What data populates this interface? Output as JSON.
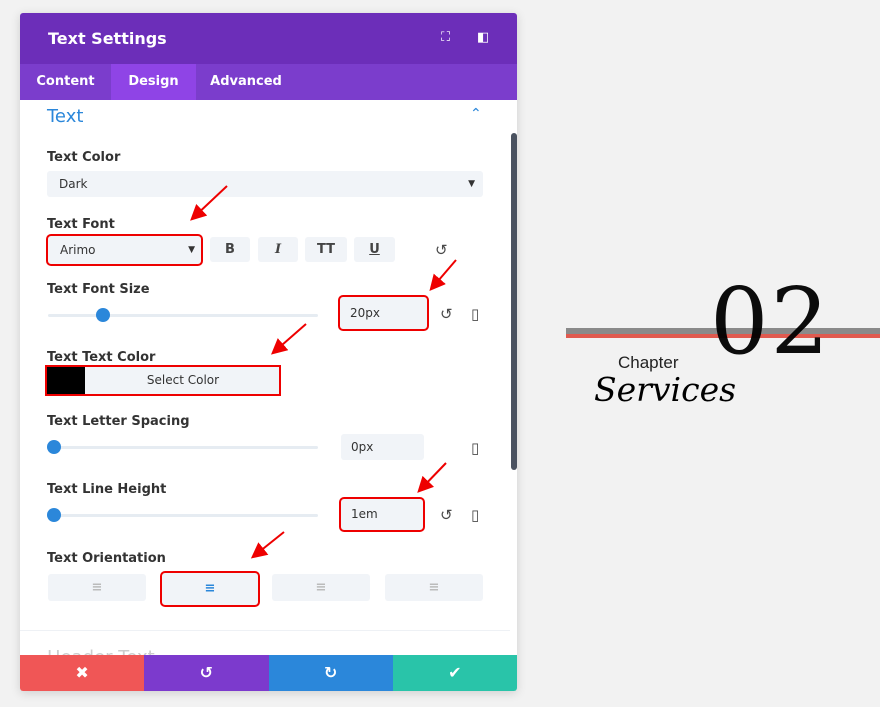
{
  "modal": {
    "title": "Text Settings",
    "icons": [
      "focus-icon",
      "sidebar-layout-icon"
    ]
  },
  "tabs": [
    {
      "label": "Content"
    },
    {
      "label": "Design",
      "active": true
    },
    {
      "label": "Advanced"
    }
  ],
  "section": {
    "title": "Text",
    "next_title": "Header Text"
  },
  "fields": {
    "text_color": {
      "label": "Text Color",
      "value": "Dark"
    },
    "text_font": {
      "label": "Text Font",
      "value": "Arimo",
      "styles": [
        "B",
        "I",
        "TT",
        "U"
      ]
    },
    "font_size": {
      "label": "Text Font Size",
      "value": "20px",
      "slider_percent": 20
    },
    "text_text_color": {
      "label": "Text Text Color",
      "swatch": "#000000",
      "button": "Select Color"
    },
    "letter_spacing": {
      "label": "Text Letter Spacing",
      "value": "0px",
      "slider_percent": 0
    },
    "line_height": {
      "label": "Text Line Height",
      "value": "1em",
      "slider_percent": 0
    },
    "orientation": {
      "label": "Text Orientation",
      "options": [
        "left",
        "center",
        "right",
        "justify"
      ],
      "selected": "center"
    }
  },
  "footer": {
    "colors": {
      "cancel": "#f05656",
      "undo": "#7c3acd",
      "redo": "#2b87da",
      "save": "#29c4a9"
    }
  },
  "preview": {
    "number": "02",
    "subtitle": "Chapter",
    "title": "Services"
  },
  "colors": {
    "header": "#6c2eb9",
    "tabs": "#7b3dcc",
    "accent": "#2b87da",
    "highlight": "#ff0000"
  }
}
